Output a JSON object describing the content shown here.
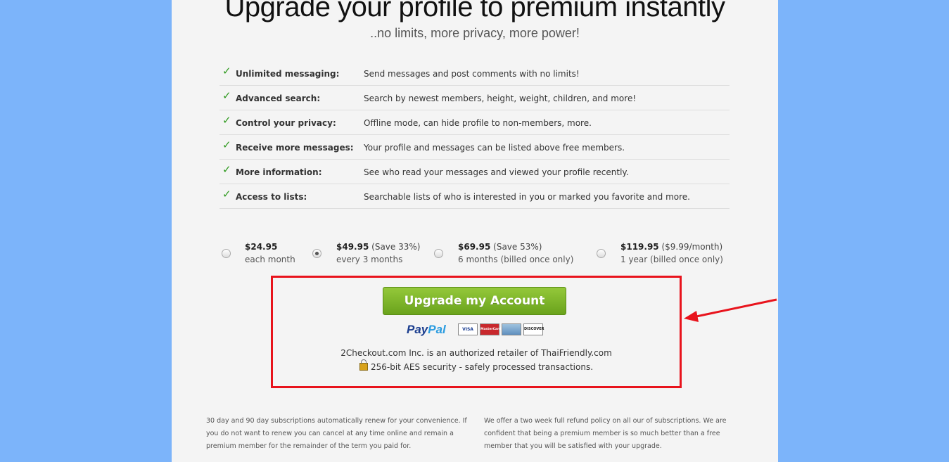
{
  "header": {
    "title": "Upgrade your profile to premium instantly",
    "subtitle": "..no limits, more privacy, more power!"
  },
  "features": [
    {
      "name": "Unlimited messaging:",
      "desc": "Send messages and post comments with no limits!"
    },
    {
      "name": "Advanced search:",
      "desc": "Search by newest members, height, weight, children, and more!"
    },
    {
      "name": "Control your privacy:",
      "desc": "Offline mode, can hide profile to non-members, more."
    },
    {
      "name": "Receive more messages:",
      "desc": "Your profile and messages can be listed above free members."
    },
    {
      "name": "More information:",
      "desc": "See who read your messages and viewed your profile recently."
    },
    {
      "name": "Access to lists:",
      "desc": "Searchable lists of who is interested in you or marked you favorite and more."
    }
  ],
  "plans": [
    {
      "price": "$24.95",
      "note": "",
      "sub": "each month",
      "selected": false
    },
    {
      "price": "$49.95",
      "note": "(Save 33%)",
      "sub": "every 3 months",
      "selected": true
    },
    {
      "price": "$69.95",
      "note": "(Save 53%)",
      "sub": "6 months (billed once only)",
      "selected": false
    },
    {
      "price": "$119.95",
      "note": "($9.99/month)",
      "sub": "1 year (billed once only)",
      "selected": false
    }
  ],
  "checkout": {
    "button_label": "Upgrade my Account",
    "paypal_pay": "Pay",
    "paypal_pal": "Pal",
    "cards": [
      "VISA",
      "MasterCard",
      "",
      "DISCOVER"
    ],
    "retailer_text": "2Checkout.com Inc. is an authorized retailer of ThaiFriendly.com",
    "security_text": "256-bit AES security - safely processed transactions."
  },
  "footer": {
    "left": "30 day and 90 day subscriptions automatically renew for your convenience. If you do not want to renew you can cancel at any time online and remain a premium member for the remainder of the term you paid for.",
    "right": "We offer a two week full refund policy on all our of subscriptions. We are confident that being a premium member is so much better than a free member that you will be satisfied with your upgrade."
  },
  "colors": {
    "page_background": "#7cb4fa",
    "panel_background": "#f4f4f4",
    "check_green": "#2f9a1f",
    "button_green": "#7cb52a",
    "annotation_red": "#e8131c"
  }
}
